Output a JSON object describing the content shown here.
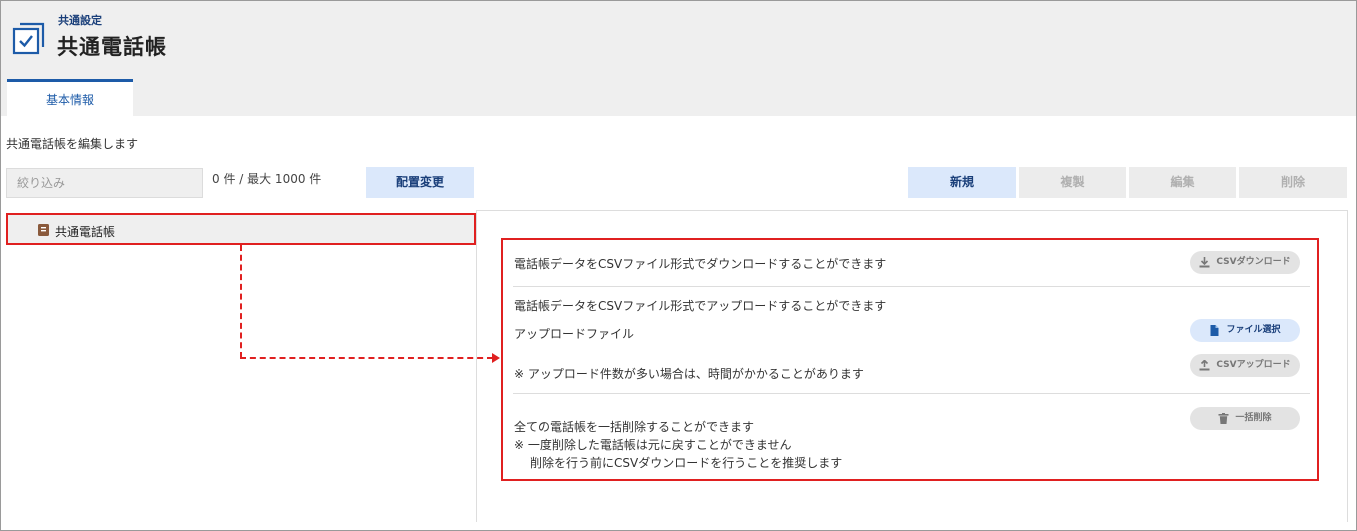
{
  "header": {
    "subtitle": "共通設定",
    "title": "共通電話帳"
  },
  "tabs": [
    {
      "label": "基本情報",
      "active": true
    }
  ],
  "description": "共通電話帳を編集します",
  "filter": {
    "placeholder": "絞り込み",
    "value": ""
  },
  "count_text": "0 件 / 最大 1000 件",
  "toolbar": {
    "rearrange_label": "配置変更",
    "new_label": "新規",
    "copy_label": "複製",
    "edit_label": "編集",
    "delete_label": "削除"
  },
  "tree": {
    "items": [
      {
        "label": "共通電話帳",
        "icon": "phonebook-icon"
      }
    ]
  },
  "csv_panel": {
    "download_text": "電話帳データをCSVファイル形式でダウンロードすることができます",
    "download_button": "CSVダウンロード",
    "upload_text": "電話帳データをCSVファイル形式でアップロードすることができます",
    "upload_file_label": "アップロードファイル",
    "file_select_button": "ファイル選択",
    "upload_note": "※ アップロード件数が多い場合は、時間がかかることがあります",
    "upload_button": "CSVアップロード",
    "delete_all_text": "全ての電話帳を一括削除することができます",
    "delete_note_1": "※ 一度削除した電話帳は元に戻すことができません",
    "delete_note_2": "削除を行う前にCSVダウンロードを行うことを推奨します",
    "delete_all_button": "一括削除"
  },
  "colors": {
    "accent": "#1d5ba8",
    "primary_button_bg": "#dbe8fb",
    "highlight": "#e02020",
    "header_bg": "#efefef"
  }
}
